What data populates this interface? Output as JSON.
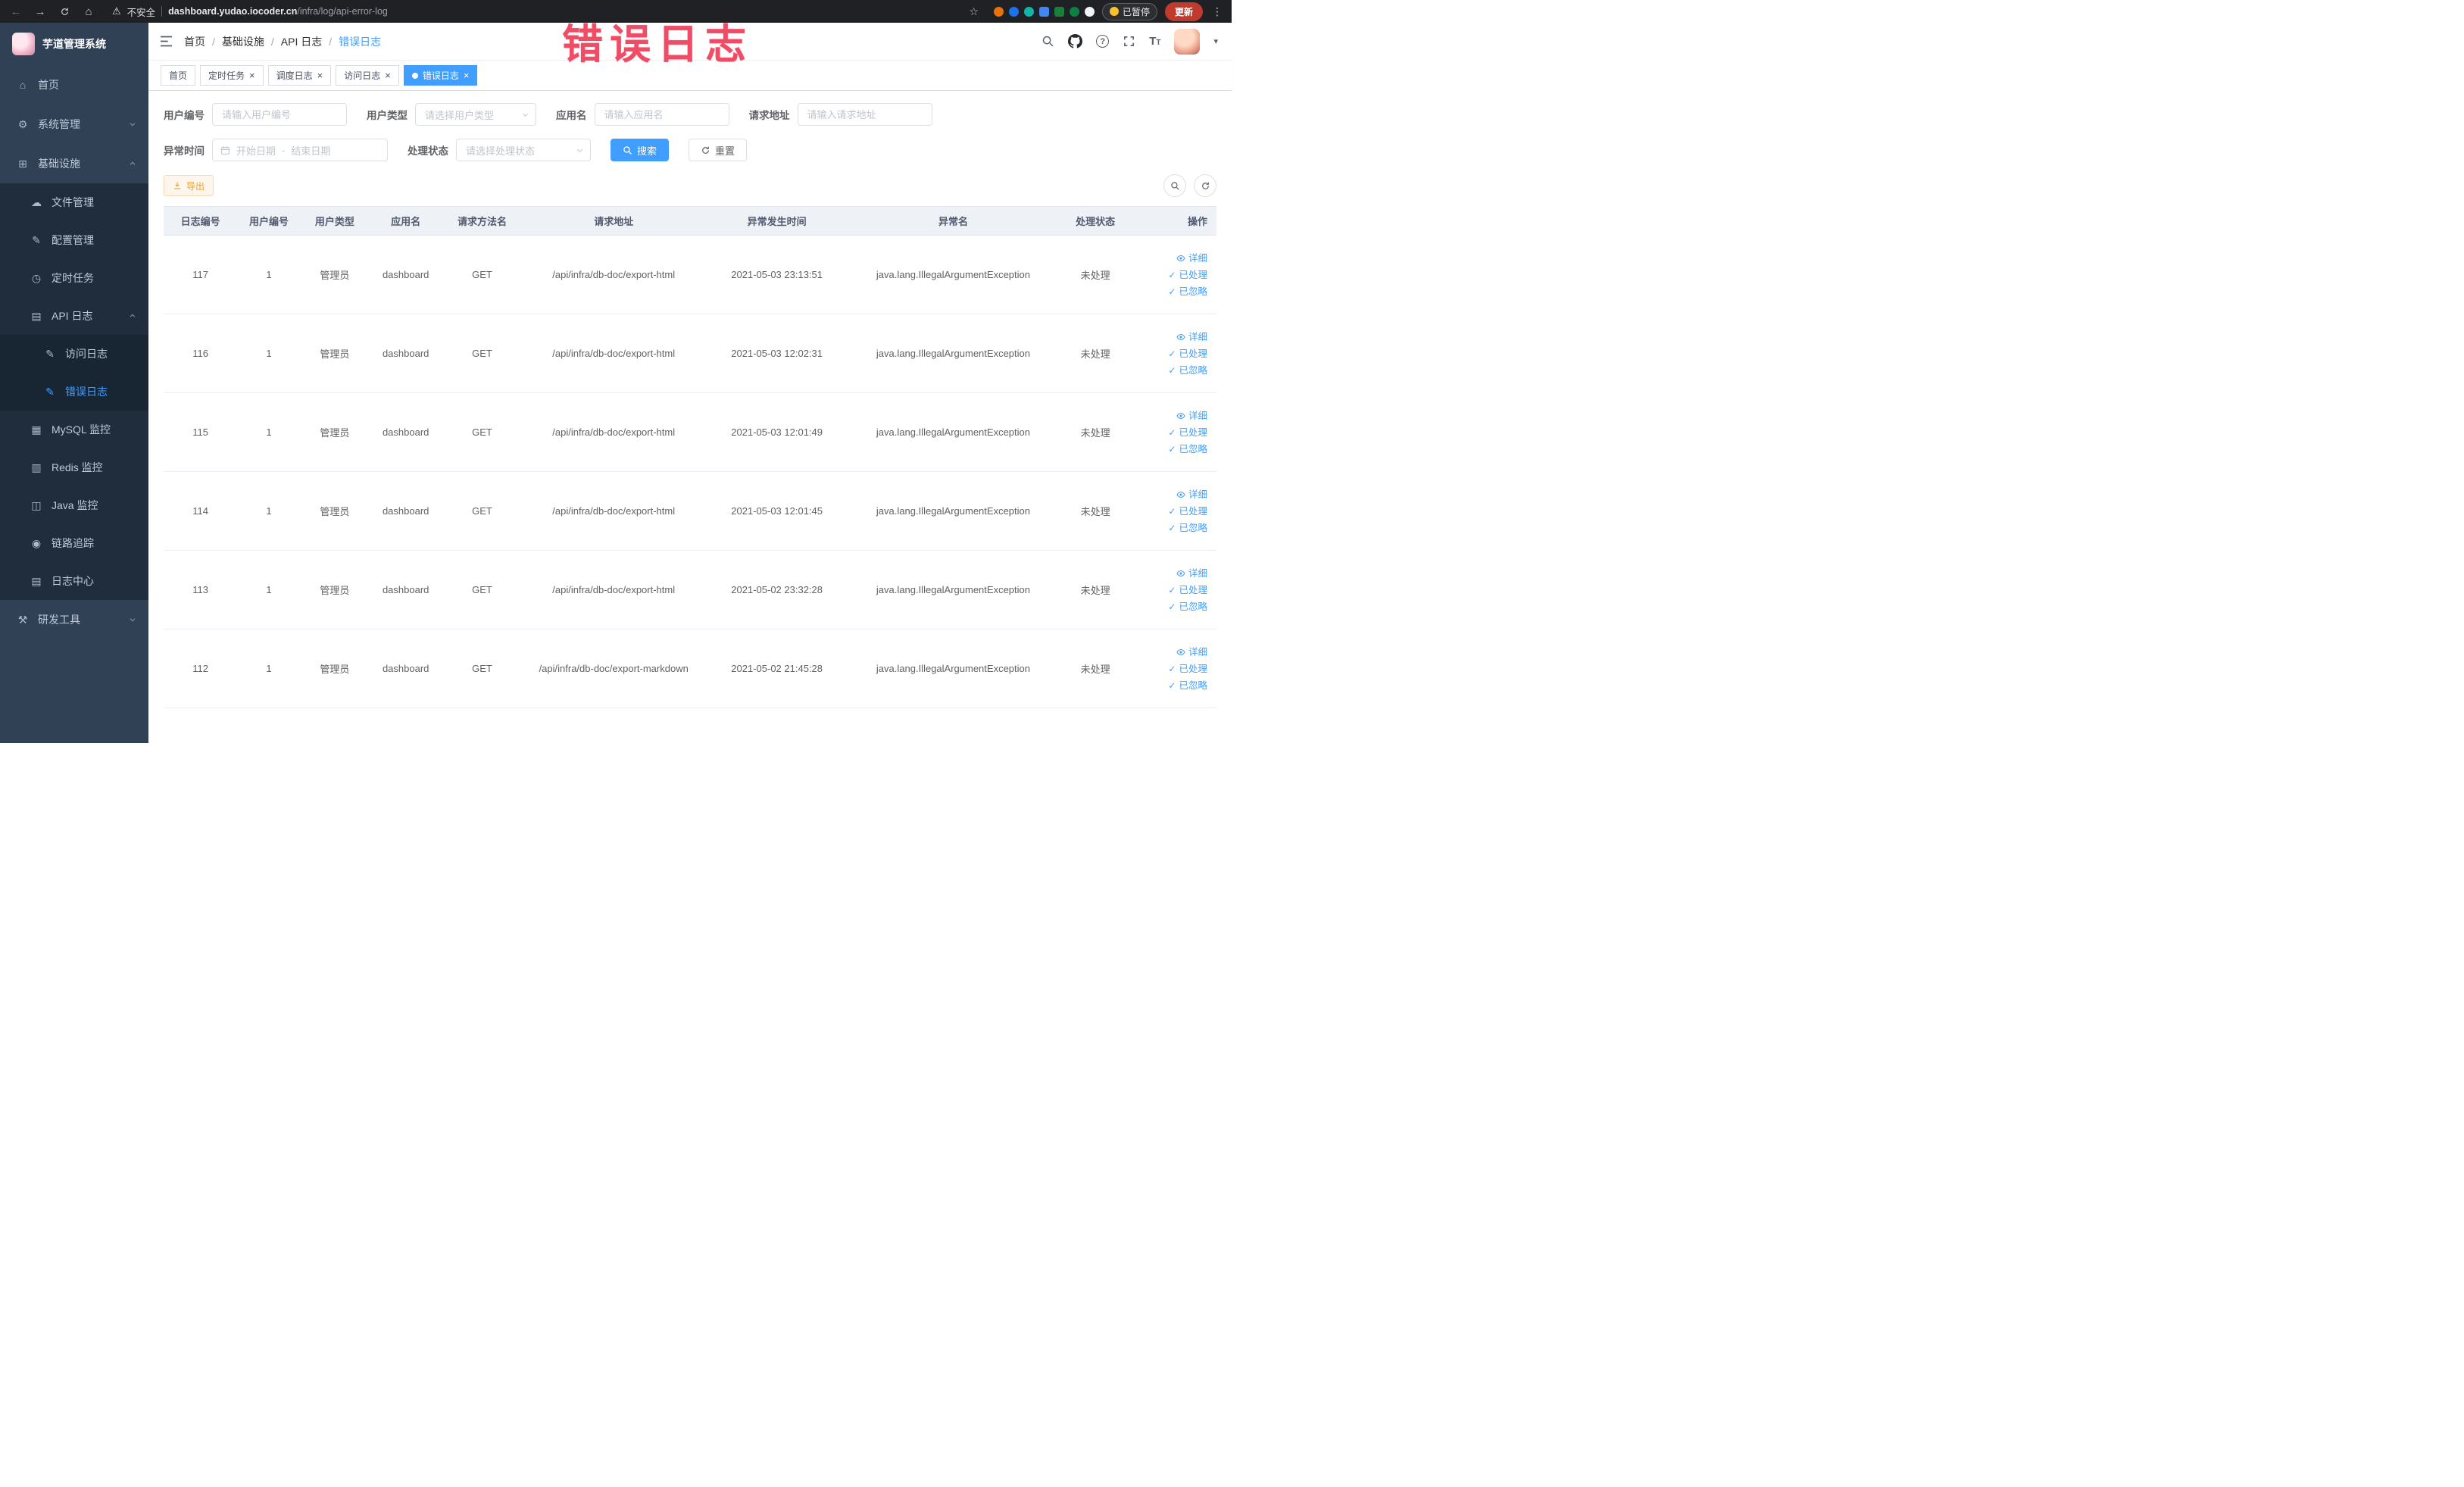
{
  "theme": {
    "primary": "#409eff",
    "warning": "#e6a23c",
    "sidebar_bg": "#304156",
    "sidebar_sub_bg": "#1f2d3d",
    "annotation_color": "#f0435e"
  },
  "annotation": "错误日志",
  "browser": {
    "security": "不安全",
    "url_host": "dashboard.yudao.iocoder.cn",
    "url_path": "/infra/log/api-error-log",
    "paused": "已暂停",
    "update": "更新"
  },
  "sidebar": {
    "title": "芋道管理系统",
    "home": "首页",
    "system": "系统管理",
    "infra": "基础设施",
    "file": "文件管理",
    "config": "配置管理",
    "job": "定时任务",
    "api_log": "API 日志",
    "access_log": "访问日志",
    "error_log": "错误日志",
    "mysql": "MySQL 监控",
    "redis": "Redis 监控",
    "java": "Java 监控",
    "trace": "链路追踪",
    "log_center": "日志中心",
    "dev_tools": "研发工具"
  },
  "header": {
    "breadcrumb": [
      "首页",
      "基础设施",
      "API 日志",
      "错误日志"
    ],
    "separator": "/"
  },
  "tabs": [
    {
      "label": "首页",
      "closable": false,
      "active": false
    },
    {
      "label": "定时任务",
      "closable": true,
      "active": false
    },
    {
      "label": "调度日志",
      "closable": true,
      "active": false
    },
    {
      "label": "访问日志",
      "closable": true,
      "active": false
    },
    {
      "label": "错误日志",
      "closable": true,
      "active": true
    }
  ],
  "filters": {
    "user_id": {
      "label": "用户编号",
      "placeholder": "请输入用户编号"
    },
    "user_type": {
      "label": "用户类型",
      "placeholder": "请选择用户类型"
    },
    "app_name": {
      "label": "应用名",
      "placeholder": "请输入应用名"
    },
    "request_url": {
      "label": "请求地址",
      "placeholder": "请输入请求地址"
    },
    "exception_time": {
      "label": "异常时间",
      "start_placeholder": "开始日期",
      "separator": "-",
      "end_placeholder": "结束日期"
    },
    "process_status": {
      "label": "处理状态",
      "placeholder": "请选择处理状态"
    },
    "search": "搜索",
    "reset": "重置"
  },
  "toolbar": {
    "export": "导出"
  },
  "table": {
    "columns": [
      "日志编号",
      "用户编号",
      "用户类型",
      "应用名",
      "请求方法名",
      "请求地址",
      "异常发生时间",
      "异常名",
      "处理状态",
      "操作"
    ],
    "actions": {
      "detail": "详细",
      "processed": "已处理",
      "ignored": "已忽略"
    },
    "rows": [
      {
        "id": "117",
        "user_id": "1",
        "user_type": "管理员",
        "app": "dashboard",
        "method": "GET",
        "url": "/api/infra/db-doc/export-html",
        "time": "2021-05-03 23:13:51",
        "exception": "java.lang.IllegalArgumentException",
        "status": "未处理"
      },
      {
        "id": "116",
        "user_id": "1",
        "user_type": "管理员",
        "app": "dashboard",
        "method": "GET",
        "url": "/api/infra/db-doc/export-html",
        "time": "2021-05-03 12:02:31",
        "exception": "java.lang.IllegalArgumentException",
        "status": "未处理"
      },
      {
        "id": "115",
        "user_id": "1",
        "user_type": "管理员",
        "app": "dashboard",
        "method": "GET",
        "url": "/api/infra/db-doc/export-html",
        "time": "2021-05-03 12:01:49",
        "exception": "java.lang.IllegalArgumentException",
        "status": "未处理"
      },
      {
        "id": "114",
        "user_id": "1",
        "user_type": "管理员",
        "app": "dashboard",
        "method": "GET",
        "url": "/api/infra/db-doc/export-html",
        "time": "2021-05-03 12:01:45",
        "exception": "java.lang.IllegalArgumentException",
        "status": "未处理"
      },
      {
        "id": "113",
        "user_id": "1",
        "user_type": "管理员",
        "app": "dashboard",
        "method": "GET",
        "url": "/api/infra/db-doc/export-html",
        "time": "2021-05-02 23:32:28",
        "exception": "java.lang.IllegalArgumentException",
        "status": "未处理"
      },
      {
        "id": "112",
        "user_id": "1",
        "user_type": "管理员",
        "app": "dashboard",
        "method": "GET",
        "url": "/api/infra/db-doc/export-markdown",
        "time": "2021-05-02 21:45:28",
        "exception": "java.lang.IllegalArgumentException",
        "status": "未处理"
      }
    ]
  }
}
